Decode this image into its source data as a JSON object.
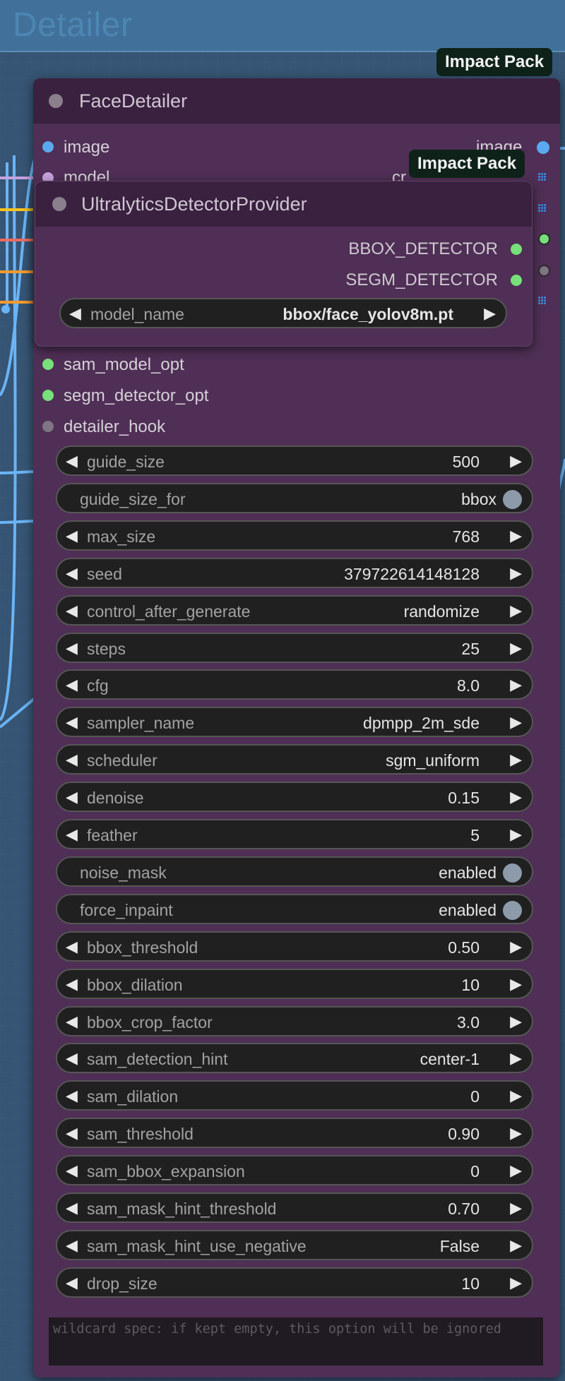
{
  "colors": {
    "group_bg": "#40709c",
    "node_body": "#4f2f55",
    "node_title": "#3a2140",
    "slot_image": "#5aa9f0",
    "slot_green": "#78e07a",
    "slot_model": "#c6a2de",
    "slot_gray": "#7f7584",
    "wire_blue": "#6ab4f5",
    "wire_yellow": "#f7c11d",
    "wire_red": "#ee6a5f",
    "wire_orange": "#f79a2e",
    "toggle_knob": "#8c9aaa",
    "badge_bg": "#0f2219"
  },
  "group": {
    "title": "Detailer"
  },
  "face_detailer": {
    "title": "FaceDetailer",
    "badge": "Impact Pack",
    "inputs": {
      "image": "image",
      "model": "model",
      "sam_model_opt": "sam_model_opt",
      "segm_detector_opt": "segm_detector_opt",
      "detailer_hook": "detailer_hook"
    },
    "outputs": {
      "image": "image",
      "partial": "cr"
    },
    "widgets": [
      {
        "label": "guide_size",
        "value": "500",
        "type": "number"
      },
      {
        "label": "guide_size_for",
        "value": "bbox",
        "type": "toggle"
      },
      {
        "label": "max_size",
        "value": "768",
        "type": "number"
      },
      {
        "label": "seed",
        "value": "379722614148128",
        "type": "number"
      },
      {
        "label": "control_after_generate",
        "value": "randomize",
        "type": "combo"
      },
      {
        "label": "steps",
        "value": "25",
        "type": "number"
      },
      {
        "label": "cfg",
        "value": "8.0",
        "type": "number"
      },
      {
        "label": "sampler_name",
        "value": "dpmpp_2m_sde",
        "type": "combo"
      },
      {
        "label": "scheduler",
        "value": "sgm_uniform",
        "type": "combo"
      },
      {
        "label": "denoise",
        "value": "0.15",
        "type": "number"
      },
      {
        "label": "feather",
        "value": "5",
        "type": "number"
      },
      {
        "label": "noise_mask",
        "value": "enabled",
        "type": "toggle"
      },
      {
        "label": "force_inpaint",
        "value": "enabled",
        "type": "toggle"
      },
      {
        "label": "bbox_threshold",
        "value": "0.50",
        "type": "number"
      },
      {
        "label": "bbox_dilation",
        "value": "10",
        "type": "number"
      },
      {
        "label": "bbox_crop_factor",
        "value": "3.0",
        "type": "number"
      },
      {
        "label": "sam_detection_hint",
        "value": "center-1",
        "type": "combo"
      },
      {
        "label": "sam_dilation",
        "value": "0",
        "type": "number"
      },
      {
        "label": "sam_threshold",
        "value": "0.90",
        "type": "number"
      },
      {
        "label": "sam_bbox_expansion",
        "value": "0",
        "type": "number"
      },
      {
        "label": "sam_mask_hint_threshold",
        "value": "0.70",
        "type": "number"
      },
      {
        "label": "sam_mask_hint_use_negative",
        "value": "False",
        "type": "combo"
      },
      {
        "label": "drop_size",
        "value": "10",
        "type": "number"
      }
    ],
    "wildcard_placeholder": "wildcard spec: if kept empty, this option will be ignored"
  },
  "ultralytics": {
    "title": "UltralyticsDetectorProvider",
    "badge": "Impact Pack",
    "outputs": {
      "bbox": "BBOX_DETECTOR",
      "segm": "SEGM_DETECTOR"
    },
    "model_name": {
      "label": "model_name",
      "value": "bbox/face_yolov8m.pt"
    }
  }
}
